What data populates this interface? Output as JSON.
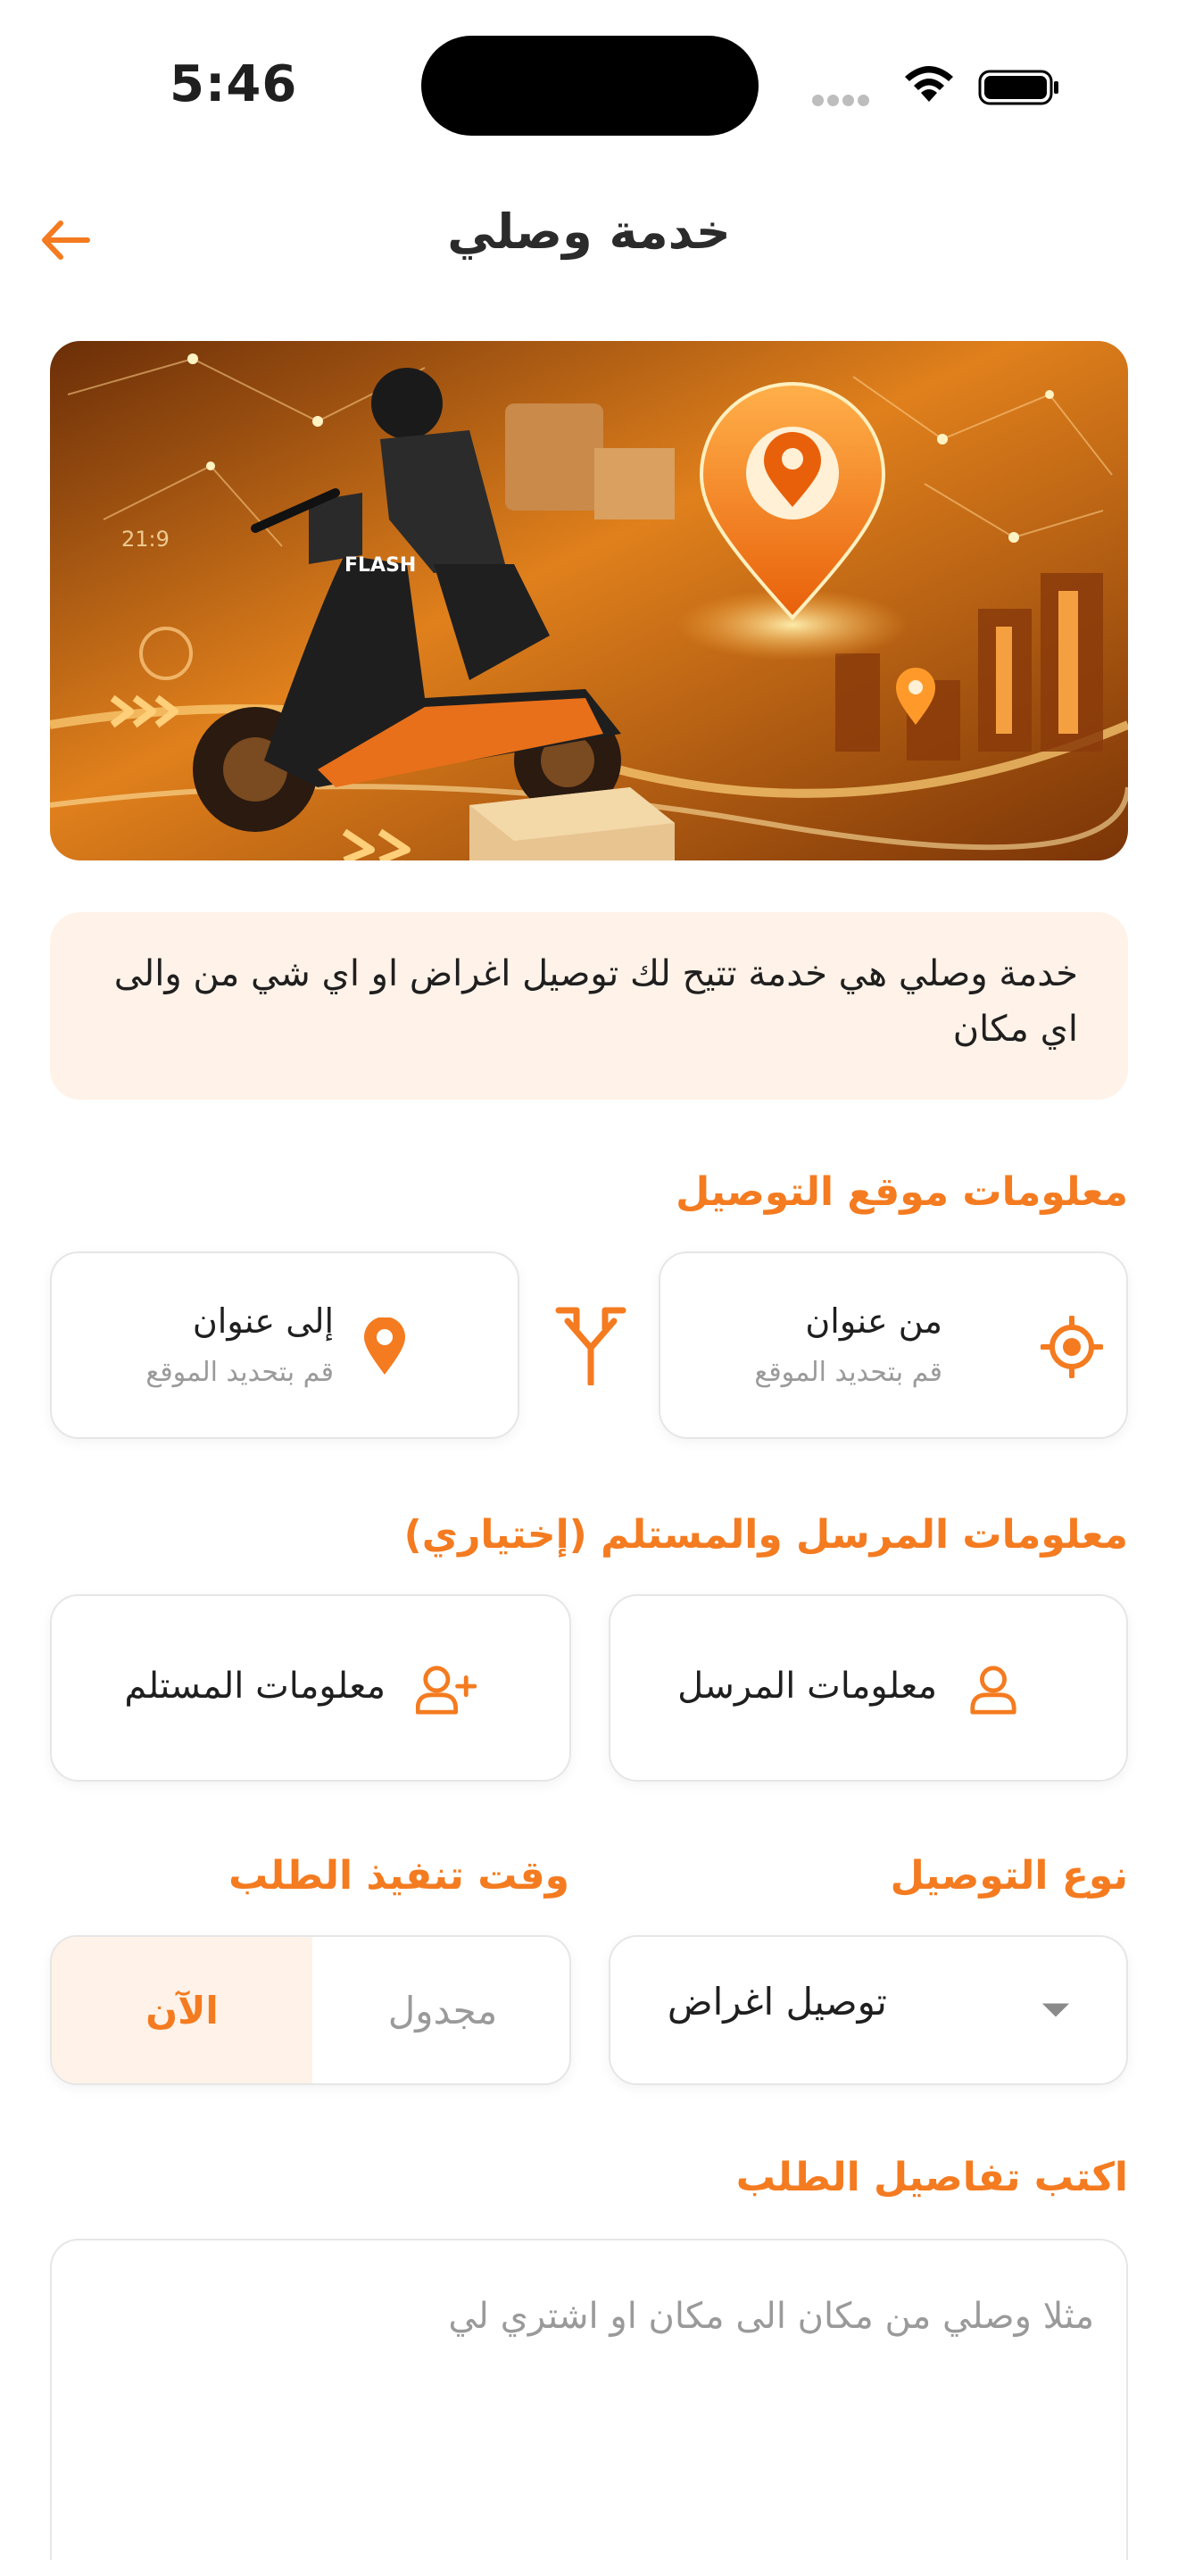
{
  "status_bar": {
    "time": "5:46"
  },
  "header": {
    "title": "خدمة وصلي"
  },
  "info": {
    "text": "خدمة وصلي هي خدمة تتيح لك توصيل اغراض او اي شي من والى اي مكان"
  },
  "location_section": {
    "title": "معلومات موقع التوصيل",
    "from": {
      "label": "من عنوان",
      "hint": "قم بتحديد الموقع"
    },
    "to": {
      "label": "إلى عنوان",
      "hint": "قم بتحديد الموقع"
    }
  },
  "parties_section": {
    "title": "معلومات المرسل والمستلم (إختياري)",
    "sender": "معلومات المرسل",
    "receiver": "معلومات المستلم"
  },
  "delivery_type": {
    "title": "نوع التوصيل",
    "value": "توصيل اغراض"
  },
  "execution_time": {
    "title": "وقت تنفيذ الطلب",
    "options": [
      "الآن",
      "مجدول"
    ],
    "selected": "الآن"
  },
  "details": {
    "title": "اكتب تفاصيل الطلب",
    "placeholder": "مثلا وصلي من مكان الى مكان او اشتري لي"
  },
  "colors": {
    "accent": "#f47b20",
    "accent_light": "#fff2e8",
    "border": "#e6e6e6",
    "muted": "#9a9a9a"
  }
}
